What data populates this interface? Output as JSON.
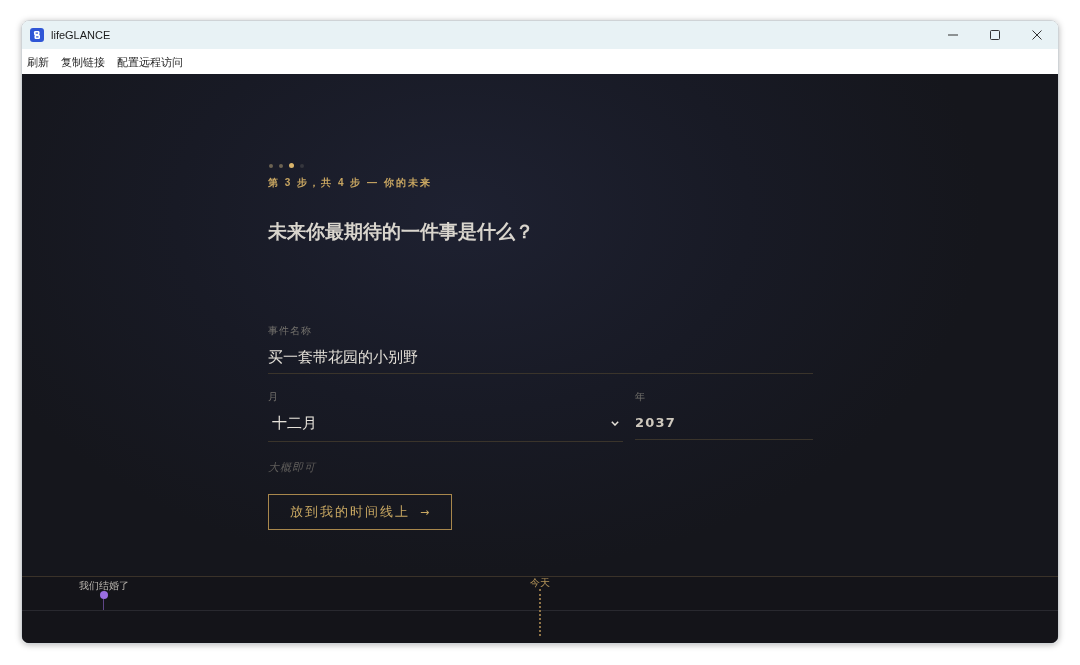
{
  "window": {
    "title": "lifeGLANCE"
  },
  "menu": [
    "刷新",
    "复制链接",
    "配置远程访问"
  ],
  "wizard": {
    "steps": [
      {
        "done": true,
        "selected": false
      },
      {
        "done": true,
        "selected": false
      },
      {
        "done": false,
        "selected": true
      },
      {
        "done": false,
        "selected": false
      }
    ],
    "step_label": "第 3 步，共 4 步 — 你的未来",
    "question": "未来你最期待的一件事是什么？"
  },
  "form": {
    "event_name": {
      "label": "事件名称",
      "value": "买一套带花园的小别野"
    },
    "month": {
      "label": "月",
      "value": "十二月"
    },
    "year": {
      "label": "年",
      "value": "2037"
    },
    "hint": "大概即可",
    "submit_button": {
      "label": "放到我的时间线上",
      "arrow": "→"
    }
  },
  "timeline": {
    "markers": [
      {
        "kind": "event",
        "label": "我们结婚了",
        "color": "#9a6ee0"
      },
      {
        "kind": "today",
        "label": "今天"
      }
    ]
  }
}
